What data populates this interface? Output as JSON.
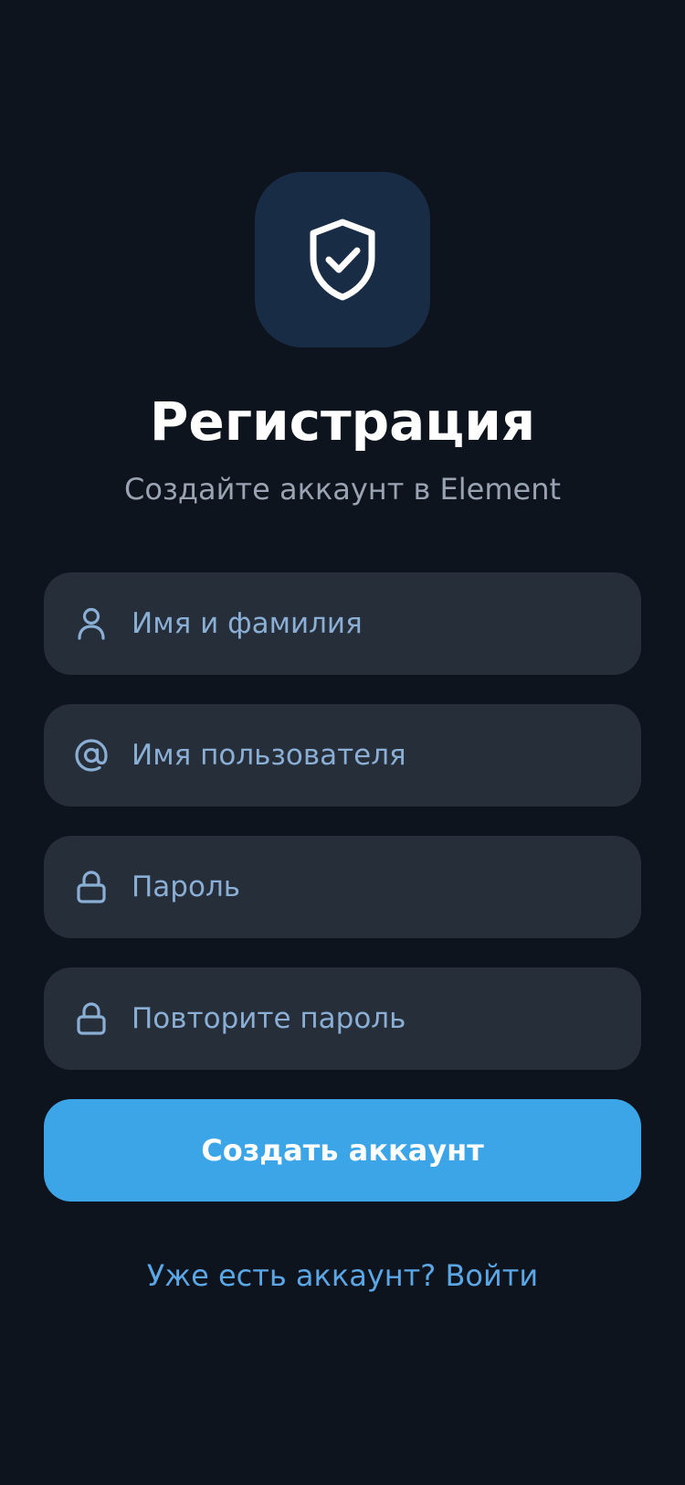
{
  "header": {
    "logo_icon": "shield-check-icon",
    "title": "Регистрация",
    "subtitle": "Создайте аккаунт в Element"
  },
  "form": {
    "full_name": {
      "placeholder": "Имя и фамилия",
      "value": "",
      "icon": "user-icon"
    },
    "username": {
      "placeholder": "Имя пользователя",
      "value": "",
      "icon": "at-sign-icon"
    },
    "password": {
      "placeholder": "Пароль",
      "value": "",
      "icon": "lock-icon"
    },
    "password_repeat": {
      "placeholder": "Повторите пароль",
      "value": "",
      "icon": "lock-icon"
    },
    "submit_label": "Создать аккаунт"
  },
  "footer": {
    "login_link": "Уже есть аккаунт? Войти"
  },
  "colors": {
    "background": "#0d141e",
    "logo_tile": "#192c46",
    "field_background": "#262e3a",
    "accent": "#3ca5e8",
    "link": "#5ba7e6",
    "placeholder": "#8aaed4"
  }
}
